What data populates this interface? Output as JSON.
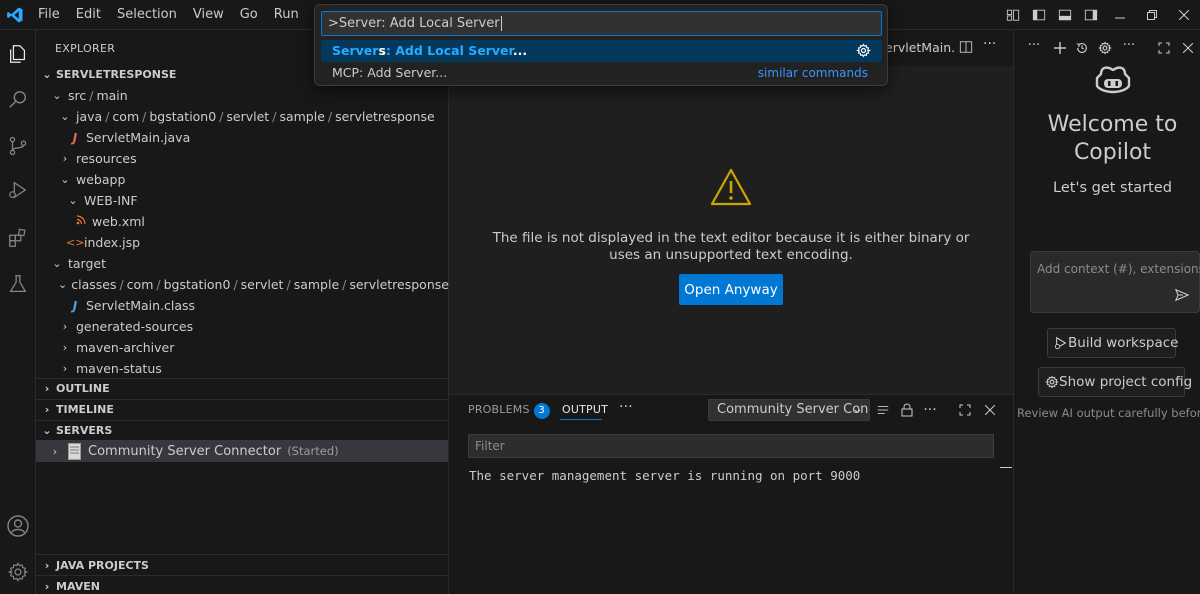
{
  "menu": [
    "File",
    "Edit",
    "Selection",
    "View",
    "Go",
    "Run",
    "···"
  ],
  "palette": {
    "input_value": ">Server: Add Local Server",
    "items": [
      {
        "prefix": "Server",
        "prefix_hl": "s",
        "sep": ": ",
        "label": "Add Local Server",
        "suffix": "..."
      },
      {
        "label": "MCP: Add Server...",
        "right": "similar commands"
      }
    ]
  },
  "sidebar": {
    "header": "EXPLORER",
    "project": "SERVLETRESPONSE",
    "tree": {
      "src_main": [
        "src",
        "main"
      ],
      "java_path": [
        "java",
        "com",
        "bgstation0",
        "servlet",
        "sample",
        "servletresponse"
      ],
      "servlet_java": "ServletMain.java",
      "resources": "resources",
      "webapp": "webapp",
      "webinf": "WEB-INF",
      "webxml": "web.xml",
      "indexjsp": "index.jsp",
      "target": "target",
      "classes_path": [
        "classes",
        "com",
        "bgstation0",
        "servlet",
        "sample",
        "servletresponse"
      ],
      "servlet_class": "ServletMain.class",
      "generated_sources": "generated-sources",
      "maven_archiver": "maven-archiver",
      "maven_status": "maven-status"
    },
    "sections": {
      "outline": "OUTLINE",
      "timeline": "TIMELINE",
      "servers": "SERVERS",
      "java_projects": "JAVA PROJECTS",
      "maven": "MAVEN"
    },
    "server_item": {
      "name": "Community Server Connector",
      "status": "(Started)"
    }
  },
  "editor": {
    "tab_fragment": "ervletMain.",
    "message_line1": "The file is not displayed in the text editor because it is either binary or",
    "message_line2": "uses an unsupported text encoding.",
    "open_button": "Open Anyway"
  },
  "panel": {
    "tab_problems": "PROBLEMS",
    "problems_count": "3",
    "tab_output": "OUTPUT",
    "more": "···",
    "output_channel": "Community Server Con",
    "filter_placeholder": "Filter",
    "output_text": "The server management server is running on port 9000"
  },
  "copilot": {
    "welcome": "Welcome to Copilot",
    "subtitle": "Let's get started",
    "input_placeholder": "Add context (#), extensions",
    "build_button": "Build workspace",
    "config_button": "Show project config",
    "review_note": "Review AI output carefully before use"
  },
  "colors": {
    "accent": "#0078d4",
    "highlight": "#2aaaff",
    "java_red": "#e06c5c",
    "java_blue": "#4fa3e0",
    "warning": "#cca700"
  }
}
